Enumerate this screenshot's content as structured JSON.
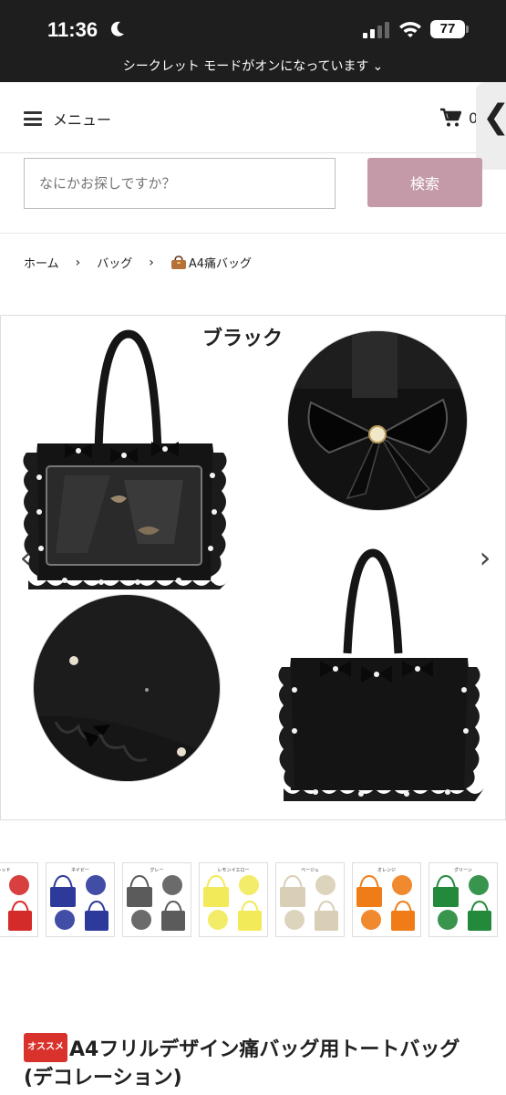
{
  "status_bar": {
    "time": "11:36",
    "battery": "77"
  },
  "incognito_banner": {
    "text": "シークレット モードがオンになっています",
    "chevron": "⌄"
  },
  "header": {
    "menu_label": "メニュー",
    "cart_count": "0",
    "side_tab_glyph": "❮"
  },
  "search": {
    "placeholder": "なにかお探しですか？",
    "button_label": "検索"
  },
  "breadcrumb": {
    "items": [
      "ホーム",
      "バッグ",
      "A4痛バッグ"
    ],
    "separator": "›"
  },
  "gallery": {
    "caption": "ブラック",
    "prev_glyph": "‹",
    "next_glyph": "›",
    "thumbnail_colors": [
      "#d42a2a",
      "#2d3a9c",
      "#5b5b5b",
      "#f2ea58",
      "#d9cfb6",
      "#f07c18",
      "#238a3b"
    ],
    "thumbnail_labels": [
      "レッド",
      "ネイビー",
      "グレー",
      "レモンイエロー",
      "ベージュ",
      "オレンジ",
      "グリーン"
    ]
  },
  "product": {
    "badge": "オススメ",
    "title": "A4フリルデザイン痛バッグ用トートバッグ (デコレーション)"
  }
}
